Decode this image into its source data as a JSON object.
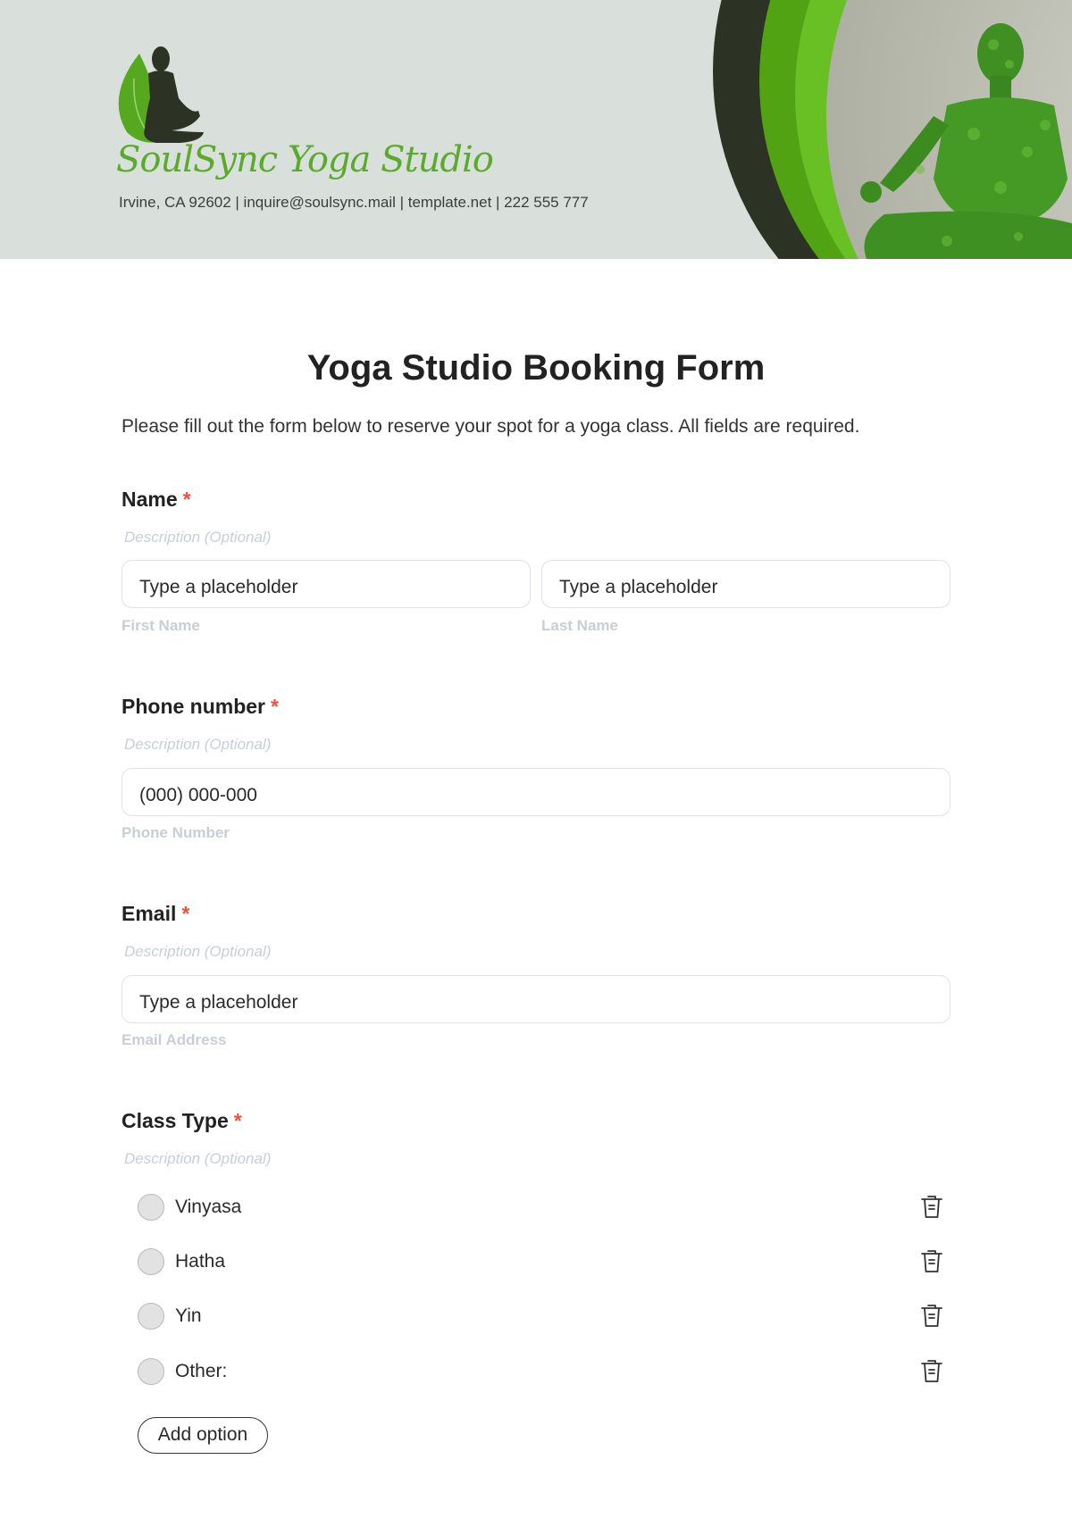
{
  "header": {
    "brand_name": "SoulSync Yoga Studio",
    "contact_line": "Irvine, CA 92602 | inquire@soulsync.mail | template.net | 222 555 777",
    "colors": {
      "background": "#d9e0db",
      "dark_green": "#2d3324",
      "mid_green": "#52a314",
      "light_green": "#68c024",
      "brand_text": "#5aab2c"
    }
  },
  "form": {
    "title": "Yoga Studio Booking Form",
    "subtitle": "Please fill out the form below to reserve your spot for a yoga class. All fields are required.",
    "required_marker": "*",
    "questions": {
      "name": {
        "label": "Name",
        "description": "Description (Optional)",
        "first_placeholder": "Type a placeholder",
        "last_placeholder": "Type a placeholder",
        "first_sublabel": "First Name",
        "last_sublabel": "Last Name"
      },
      "phone": {
        "label": "Phone number",
        "description": "Description (Optional)",
        "placeholder": "(000) 000-000",
        "sublabel": "Phone Number"
      },
      "email": {
        "label": "Email",
        "description": "Description (Optional)",
        "placeholder": "Type a placeholder",
        "sublabel": "Email Address"
      },
      "class_type": {
        "label": "Class Type",
        "description": "Description (Optional)",
        "options": [
          {
            "label": "Vinyasa",
            "icon": "trash-icon"
          },
          {
            "label": "Hatha",
            "icon": "trash-icon"
          },
          {
            "label": "Yin",
            "icon": "trash-icon"
          },
          {
            "label": "Other:",
            "icon": "trash-icon"
          }
        ],
        "add_option_label": "Add option"
      }
    },
    "colors": {
      "required": "#f0513c",
      "muted": "#c9ced6",
      "field_border": "#dfe2e7"
    }
  }
}
